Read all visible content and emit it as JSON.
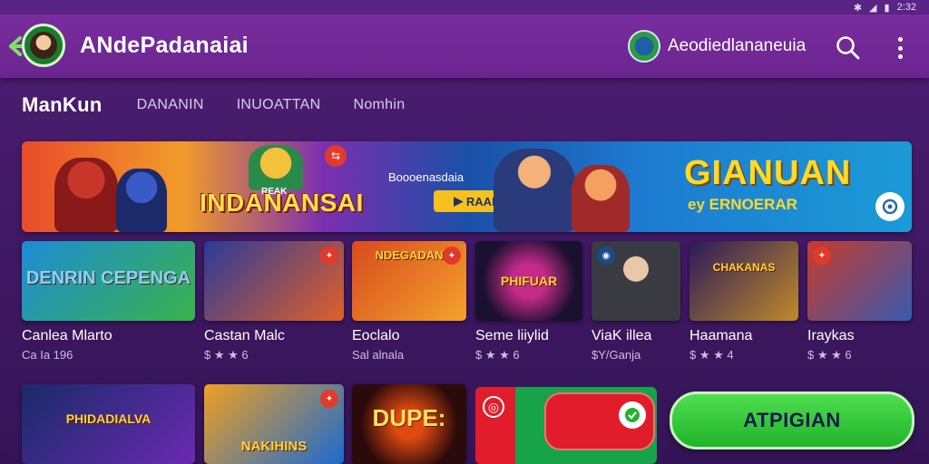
{
  "status_bar": {
    "icons": [
      "bluetooth-icon",
      "signal-icon",
      "battery-icon"
    ],
    "time": "2:32"
  },
  "app_bar": {
    "title": "ANdePadanaiai",
    "account_name": "Aeodiedlananeuia",
    "icons": [
      "back-arrow-icon",
      "search-icon",
      "more-vert-icon"
    ]
  },
  "tabs": [
    {
      "label": "ManKun",
      "active": true
    },
    {
      "label": "DANANIN",
      "active": false
    },
    {
      "label": "INUOATTAN",
      "active": false
    },
    {
      "label": "Nomhin",
      "active": false
    }
  ],
  "banner": {
    "left_title": "INDANANSAI",
    "small_title": "REAK",
    "subtitle": "Boooenasdaia",
    "play_label": "RAAI",
    "right_title": "GIANUAN",
    "right_subtitle": "ey ERNOERAR"
  },
  "games_row1": [
    {
      "title": "Canlea Mlarto",
      "rating": "Ca Ia 196",
      "art_text": "DENRIN CEPENGA",
      "art_colors": [
        "#1d8bd6",
        "#39b34a"
      ]
    },
    {
      "title": "Castan Malc",
      "rating": "$ ★ ★ 6",
      "art_text": "",
      "art_colors": [
        "#2a3a9a",
        "#e0602a"
      ]
    },
    {
      "title": "Eoclalo",
      "rating": "Sal alnala",
      "art_text": "NDEGADAN",
      "art_colors": [
        "#d94a1f",
        "#f3a22c"
      ]
    },
    {
      "title": "Seme liiylid",
      "rating": "$ ★ ★ 6",
      "art_text": "PHIFUAR",
      "art_colors": [
        "#1a1030",
        "#c42a8a"
      ]
    },
    {
      "title": "ViaK illea",
      "rating": "$Y/Ganja",
      "art_text": "",
      "art_colors": [
        "#3a3a42",
        "#8a8a90"
      ]
    },
    {
      "title": "Haamana",
      "rating": "$ ★ ★ 4",
      "art_text": "CHAKANAS",
      "art_colors": [
        "#2a1a5a",
        "#c08a2a"
      ]
    },
    {
      "title": "Iraykas",
      "rating": "$ ★ ★ 6",
      "art_text": "",
      "art_colors": [
        "#c83a2a",
        "#3a5ab0"
      ]
    }
  ],
  "games_row2": [
    {
      "art_text": "PHIDADIALVA",
      "art_colors": [
        "#1a2a6a",
        "#6a2ab0"
      ]
    },
    {
      "art_text": "NAKIHINS",
      "art_colors": [
        "#f0a020",
        "#1a6ad0"
      ]
    },
    {
      "art_text": "DUPE:",
      "art_colors": [
        "#2a0a0a",
        "#e04a10"
      ]
    }
  ],
  "promo": {
    "icons": [
      "target-icon",
      "check-circle-icon"
    ]
  },
  "install_button": {
    "label": "ATPIGIAN"
  },
  "colors": {
    "accent": "#6a2590",
    "background": "#3f1863",
    "install": "#22b32c",
    "promo_red": "#e11d2b"
  }
}
